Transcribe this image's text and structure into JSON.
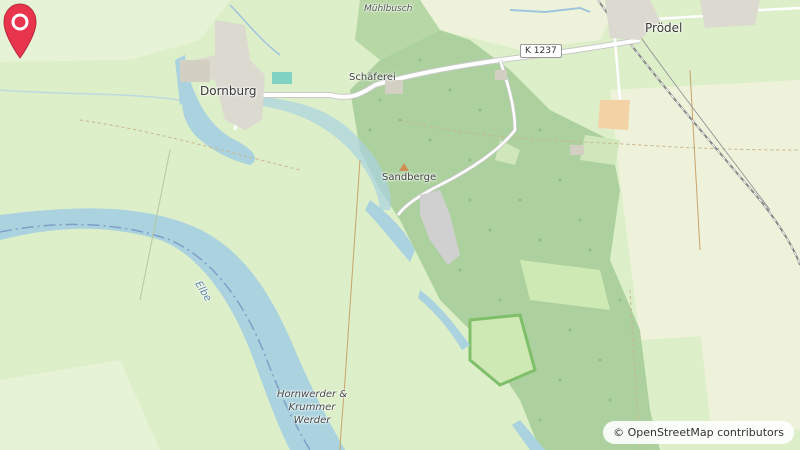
{
  "map": {
    "places": {
      "dornburg": "Dornburg",
      "proedel": "Prödel",
      "schaeferei": "Schäferei",
      "muehlbusch": "Mühlbusch",
      "sandberge": "Sandberge",
      "elbe": "Elbe",
      "werder": "Hornwerder & Krummer Werder"
    },
    "road_ref": "K 1237",
    "attribution": {
      "symbol": "©",
      "text": "OpenStreetMap contributors"
    },
    "colors": {
      "grassland": "#dcefc8",
      "forest": "#add19e",
      "water": "#aad3df",
      "road": "#ffffff",
      "marker": "#e8344c"
    }
  }
}
